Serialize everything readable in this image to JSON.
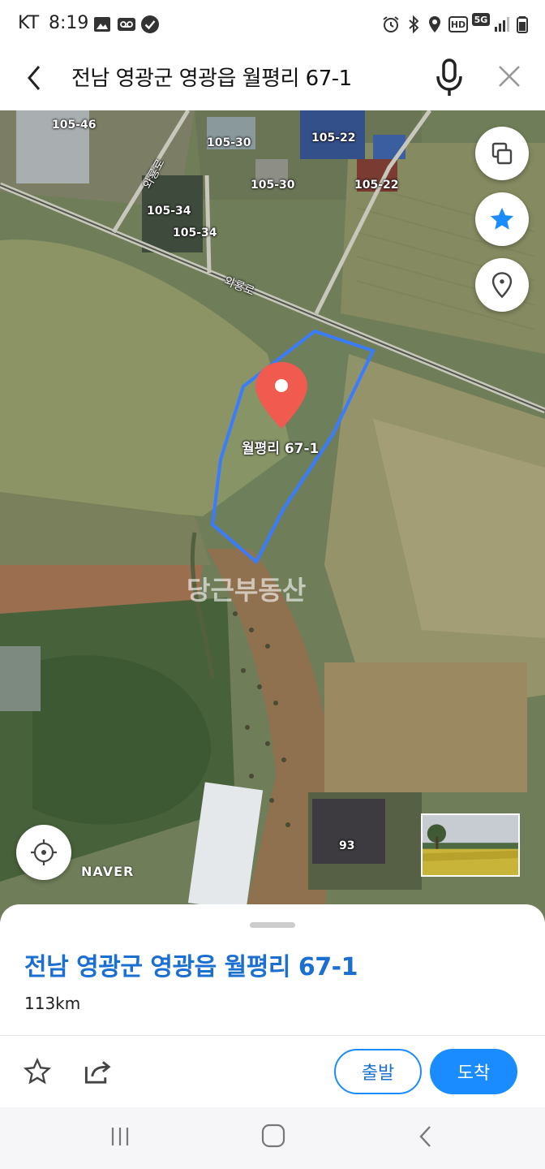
{
  "status_bar": {
    "carrier": "KT",
    "time": "8:19",
    "left_icons": [
      "image-icon",
      "voicemail-icon",
      "check-circle-icon"
    ],
    "right_icons": [
      "alarm-icon",
      "bluetooth-icon",
      "location-icon",
      "hd-icon",
      "5g-icon",
      "signal-icon",
      "battery-icon"
    ],
    "hd_label": "HD",
    "network_label": "5G"
  },
  "search_header": {
    "query": "전남 영광군 영광읍 월평리 67-1"
  },
  "map": {
    "parcel_labels": [
      "105-46",
      "105-30",
      "105-22",
      "105-30",
      "105-22",
      "105-34",
      "105-34",
      "93"
    ],
    "road_labels": [
      "와룡로",
      "와룡로"
    ],
    "pin_label": "월평리 67-1",
    "watermark": "당근부동산",
    "provider_logo": "NAVER",
    "parcel_outline_color": "#3a7cff",
    "pin_color": "#f05a4f"
  },
  "bottom_sheet": {
    "title": "전남 영광군 영광읍 월평리 67-1",
    "distance": "113km",
    "depart_label": "출발",
    "arrive_label": "도착"
  },
  "colors": {
    "accent": "#1a8cff",
    "title_blue": "#1a6fd0"
  }
}
